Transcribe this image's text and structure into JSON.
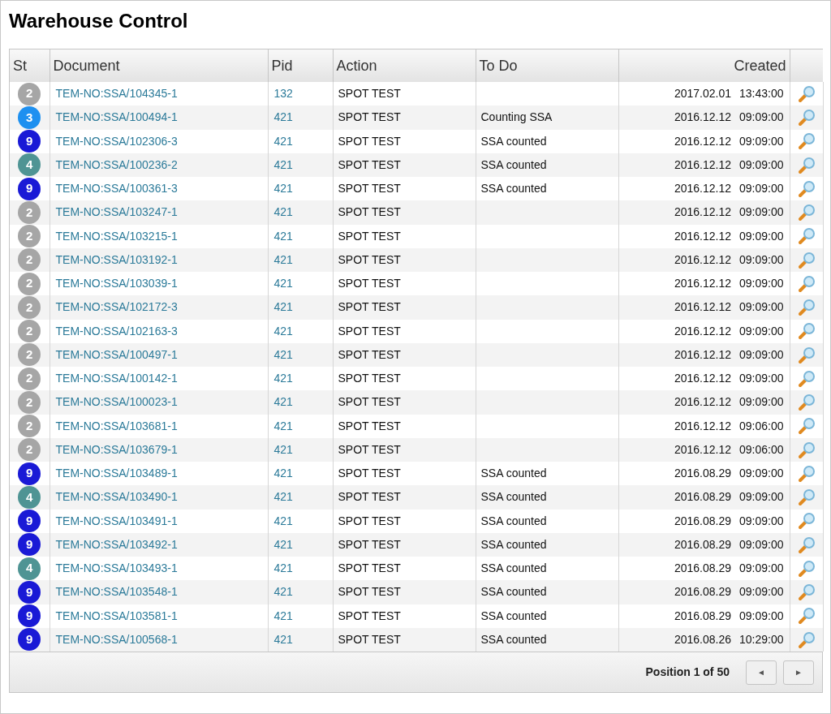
{
  "title": "Warehouse Control",
  "columns": [
    "St",
    "Document",
    "Pid",
    "Action",
    "To Do",
    "Created"
  ],
  "rows": [
    {
      "status": "2",
      "color": "#a6a6a6",
      "document": "TEM-NO:SSA/104345-1",
      "pid": "132",
      "action": "SPOT TEST",
      "todo": "",
      "date": "2017.02.01",
      "time": "13:43:00"
    },
    {
      "status": "3",
      "color": "#1e90f0",
      "document": "TEM-NO:SSA/100494-1",
      "pid": "421",
      "action": "SPOT TEST",
      "todo": "Counting SSA",
      "date": "2016.12.12",
      "time": "09:09:00"
    },
    {
      "status": "9",
      "color": "#1a1ad6",
      "document": "TEM-NO:SSA/102306-3",
      "pid": "421",
      "action": "SPOT TEST",
      "todo": "SSA counted",
      "date": "2016.12.12",
      "time": "09:09:00"
    },
    {
      "status": "4",
      "color": "#4f9494",
      "document": "TEM-NO:SSA/100236-2",
      "pid": "421",
      "action": "SPOT TEST",
      "todo": "SSA counted",
      "date": "2016.12.12",
      "time": "09:09:00"
    },
    {
      "status": "9",
      "color": "#1a1ad6",
      "document": "TEM-NO:SSA/100361-3",
      "pid": "421",
      "action": "SPOT TEST",
      "todo": "SSA counted",
      "date": "2016.12.12",
      "time": "09:09:00"
    },
    {
      "status": "2",
      "color": "#a6a6a6",
      "document": "TEM-NO:SSA/103247-1",
      "pid": "421",
      "action": "SPOT TEST",
      "todo": "",
      "date": "2016.12.12",
      "time": "09:09:00"
    },
    {
      "status": "2",
      "color": "#a6a6a6",
      "document": "TEM-NO:SSA/103215-1",
      "pid": "421",
      "action": "SPOT TEST",
      "todo": "",
      "date": "2016.12.12",
      "time": "09:09:00"
    },
    {
      "status": "2",
      "color": "#a6a6a6",
      "document": "TEM-NO:SSA/103192-1",
      "pid": "421",
      "action": "SPOT TEST",
      "todo": "",
      "date": "2016.12.12",
      "time": "09:09:00"
    },
    {
      "status": "2",
      "color": "#a6a6a6",
      "document": "TEM-NO:SSA/103039-1",
      "pid": "421",
      "action": "SPOT TEST",
      "todo": "",
      "date": "2016.12.12",
      "time": "09:09:00"
    },
    {
      "status": "2",
      "color": "#a6a6a6",
      "document": "TEM-NO:SSA/102172-3",
      "pid": "421",
      "action": "SPOT TEST",
      "todo": "",
      "date": "2016.12.12",
      "time": "09:09:00"
    },
    {
      "status": "2",
      "color": "#a6a6a6",
      "document": "TEM-NO:SSA/102163-3",
      "pid": "421",
      "action": "SPOT TEST",
      "todo": "",
      "date": "2016.12.12",
      "time": "09:09:00"
    },
    {
      "status": "2",
      "color": "#a6a6a6",
      "document": "TEM-NO:SSA/100497-1",
      "pid": "421",
      "action": "SPOT TEST",
      "todo": "",
      "date": "2016.12.12",
      "time": "09:09:00"
    },
    {
      "status": "2",
      "color": "#a6a6a6",
      "document": "TEM-NO:SSA/100142-1",
      "pid": "421",
      "action": "SPOT TEST",
      "todo": "",
      "date": "2016.12.12",
      "time": "09:09:00"
    },
    {
      "status": "2",
      "color": "#a6a6a6",
      "document": "TEM-NO:SSA/100023-1",
      "pid": "421",
      "action": "SPOT TEST",
      "todo": "",
      "date": "2016.12.12",
      "time": "09:09:00"
    },
    {
      "status": "2",
      "color": "#a6a6a6",
      "document": "TEM-NO:SSA/103681-1",
      "pid": "421",
      "action": "SPOT TEST",
      "todo": "",
      "date": "2016.12.12",
      "time": "09:06:00"
    },
    {
      "status": "2",
      "color": "#a6a6a6",
      "document": "TEM-NO:SSA/103679-1",
      "pid": "421",
      "action": "SPOT TEST",
      "todo": "",
      "date": "2016.12.12",
      "time": "09:06:00"
    },
    {
      "status": "9",
      "color": "#1a1ad6",
      "document": "TEM-NO:SSA/103489-1",
      "pid": "421",
      "action": "SPOT TEST",
      "todo": "SSA counted",
      "date": "2016.08.29",
      "time": "09:09:00"
    },
    {
      "status": "4",
      "color": "#4f9494",
      "document": "TEM-NO:SSA/103490-1",
      "pid": "421",
      "action": "SPOT TEST",
      "todo": "SSA counted",
      "date": "2016.08.29",
      "time": "09:09:00"
    },
    {
      "status": "9",
      "color": "#1a1ad6",
      "document": "TEM-NO:SSA/103491-1",
      "pid": "421",
      "action": "SPOT TEST",
      "todo": "SSA counted",
      "date": "2016.08.29",
      "time": "09:09:00"
    },
    {
      "status": "9",
      "color": "#1a1ad6",
      "document": "TEM-NO:SSA/103492-1",
      "pid": "421",
      "action": "SPOT TEST",
      "todo": "SSA counted",
      "date": "2016.08.29",
      "time": "09:09:00"
    },
    {
      "status": "4",
      "color": "#4f9494",
      "document": "TEM-NO:SSA/103493-1",
      "pid": "421",
      "action": "SPOT TEST",
      "todo": "SSA counted",
      "date": "2016.08.29",
      "time": "09:09:00"
    },
    {
      "status": "9",
      "color": "#1a1ad6",
      "document": "TEM-NO:SSA/103548-1",
      "pid": "421",
      "action": "SPOT TEST",
      "todo": "SSA counted",
      "date": "2016.08.29",
      "time": "09:09:00"
    },
    {
      "status": "9",
      "color": "#1a1ad6",
      "document": "TEM-NO:SSA/103581-1",
      "pid": "421",
      "action": "SPOT TEST",
      "todo": "SSA counted",
      "date": "2016.08.29",
      "time": "09:09:00"
    },
    {
      "status": "9",
      "color": "#1a1ad6",
      "document": "TEM-NO:SSA/100568-1",
      "pid": "421",
      "action": "SPOT TEST",
      "todo": "SSA counted",
      "date": "2016.08.26",
      "time": "10:29:00"
    }
  ],
  "pager": {
    "position": "Position 1 of 50",
    "prev": "◄",
    "next": "►"
  }
}
